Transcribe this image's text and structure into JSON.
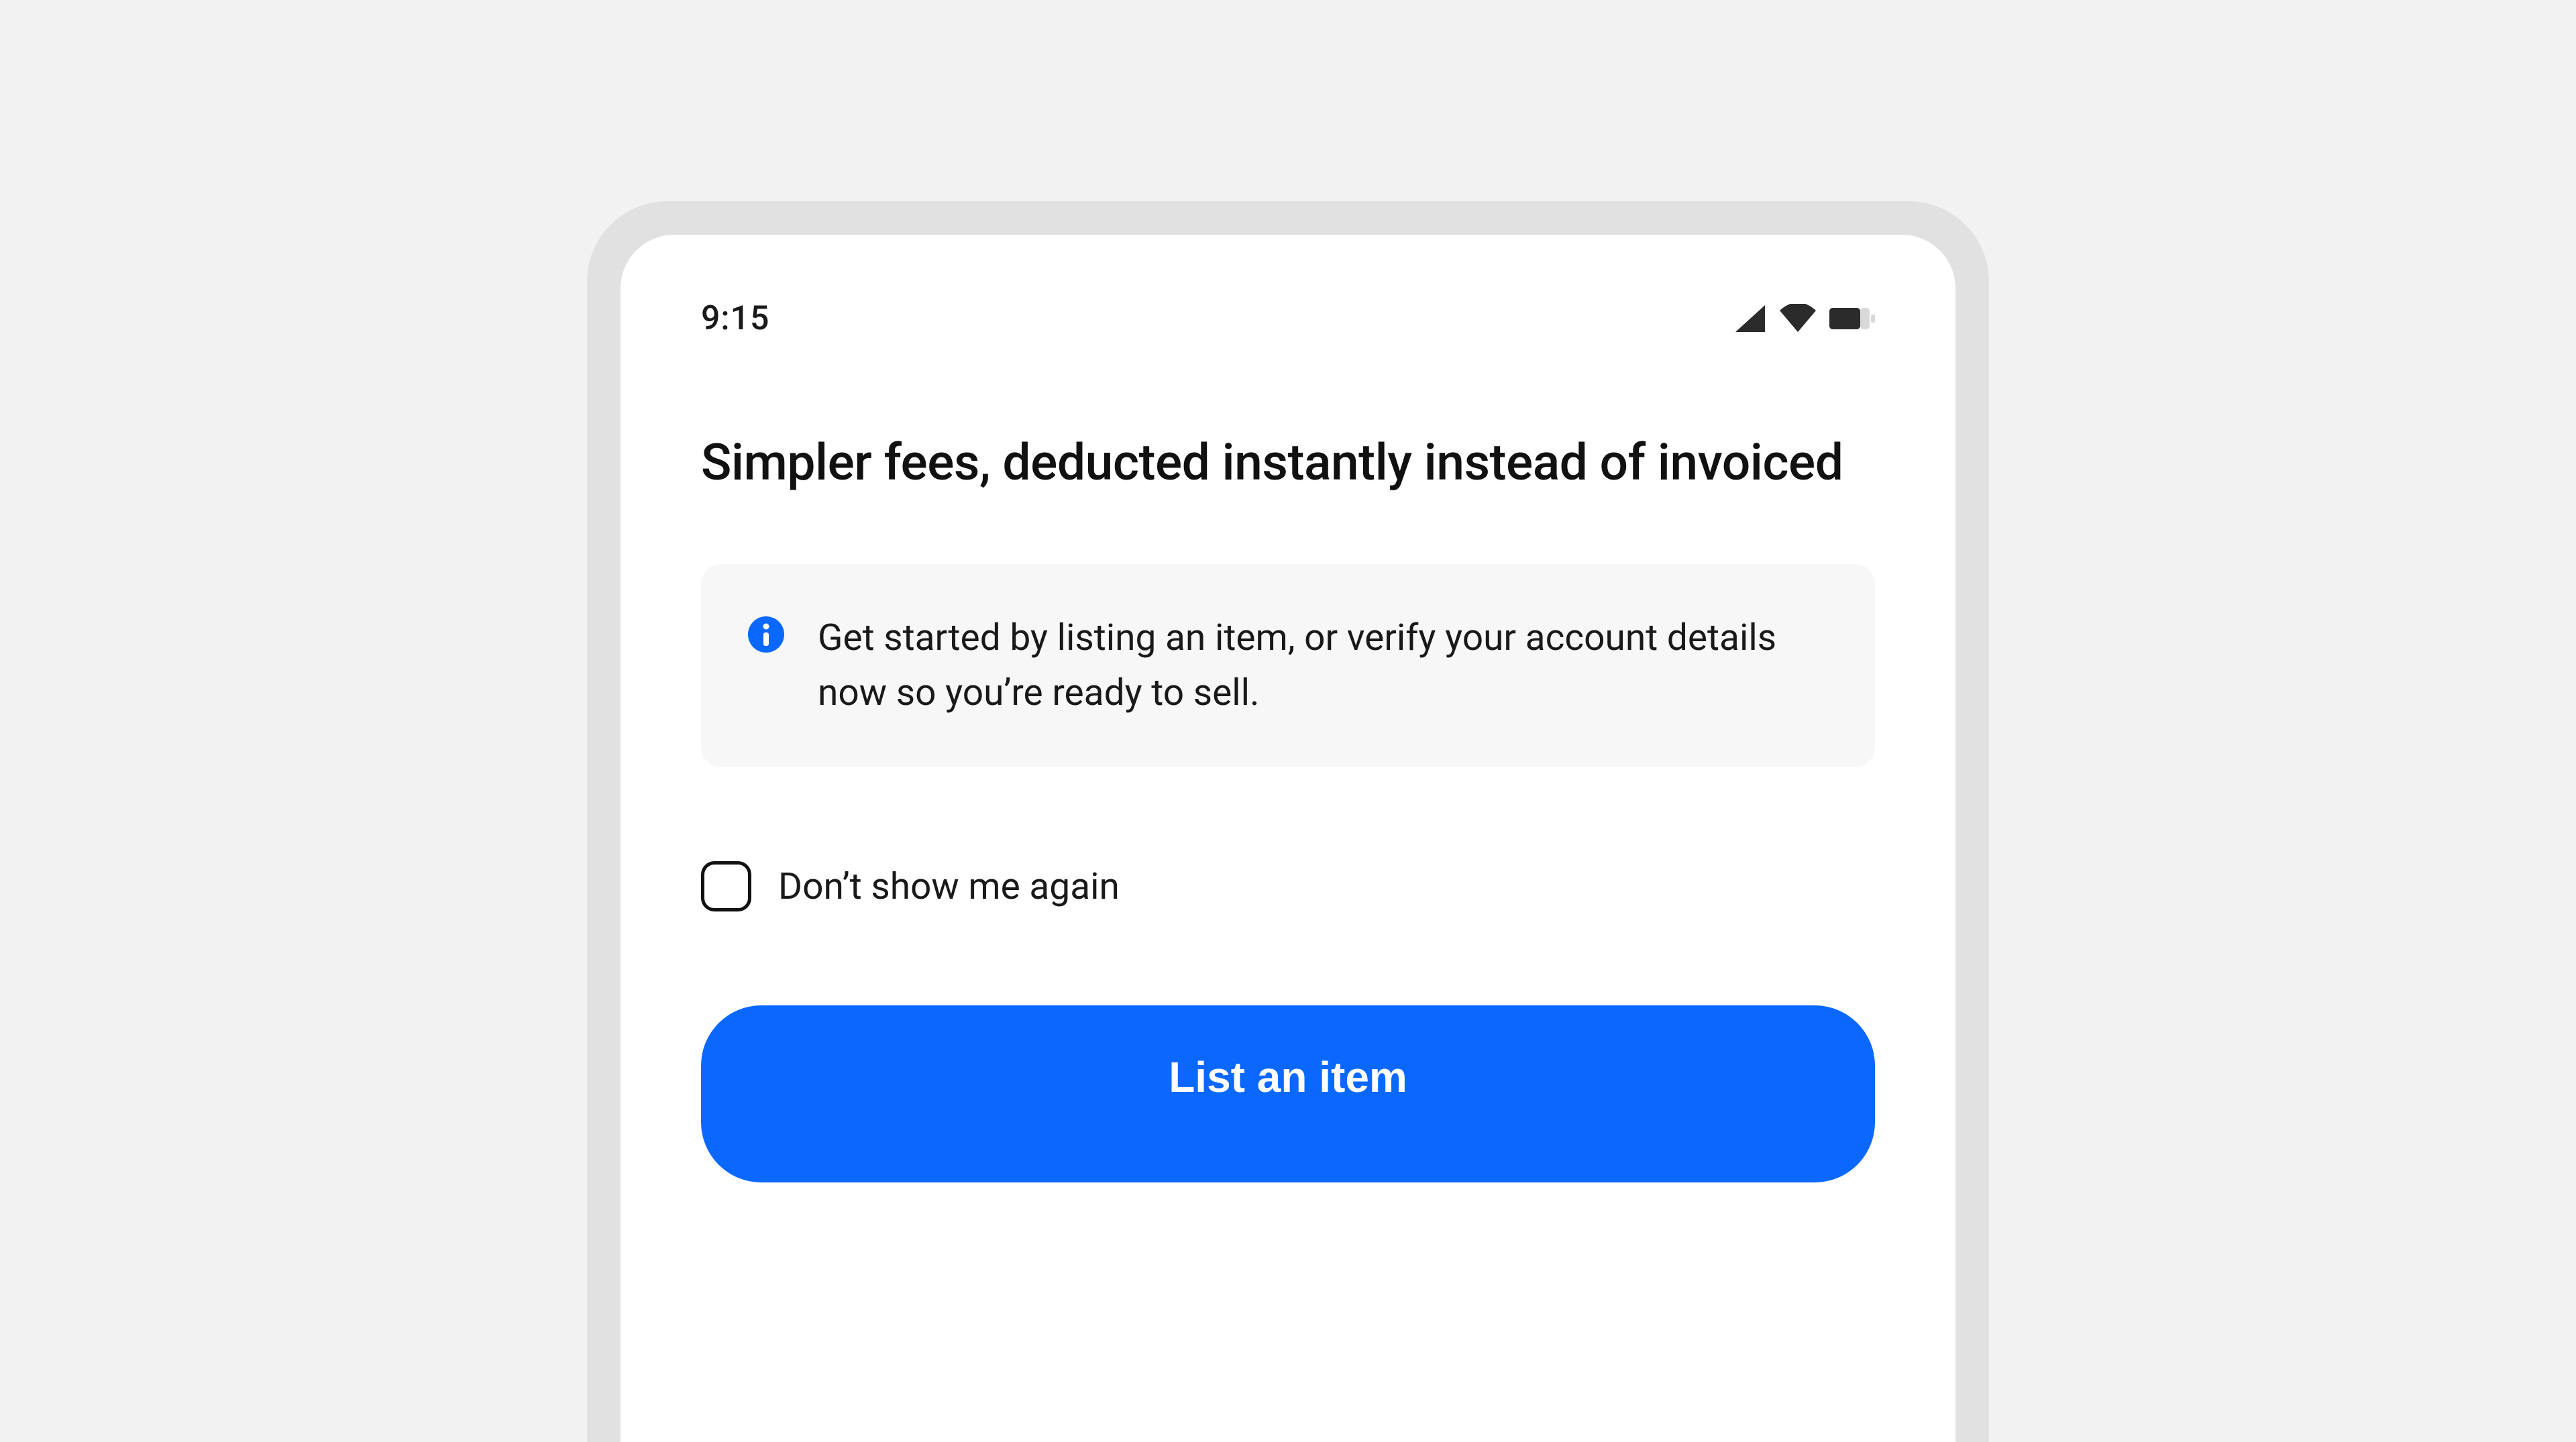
{
  "status_bar": {
    "time": "9:15"
  },
  "heading": "Simpler fees, deducted instantly instead of invoiced",
  "info_card": {
    "text": "Get started by listing an item, or verify your account details now so you’re ready to sell."
  },
  "checkbox": {
    "label": "Don’t show me again",
    "checked": false
  },
  "primary_button": {
    "label": "List an item"
  },
  "colors": {
    "accent": "#0a68ff",
    "page_bg": "#f2f2f2",
    "frame_bg": "#e1e1e1",
    "card_bg": "#f7f7f7"
  }
}
